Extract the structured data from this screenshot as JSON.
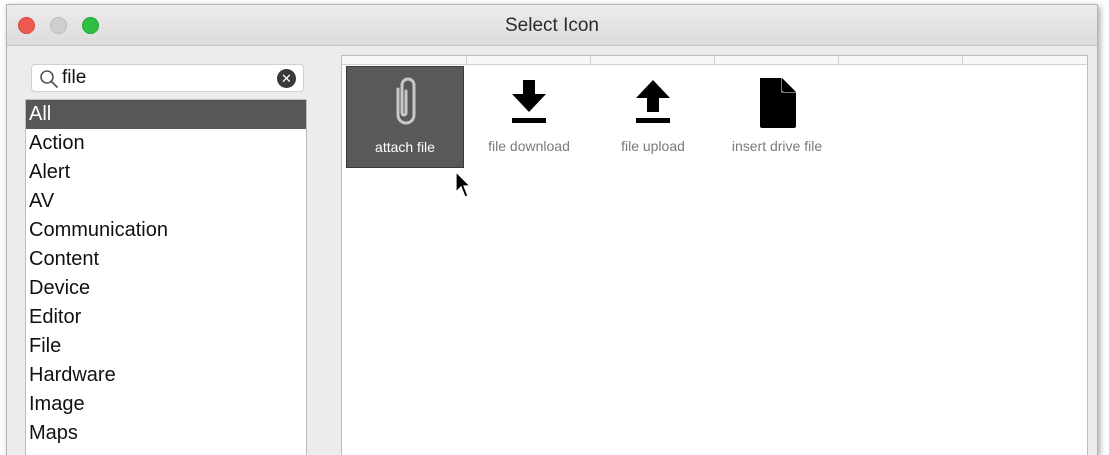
{
  "window": {
    "title": "Select Icon"
  },
  "search": {
    "value": "file"
  },
  "categories": [
    "All",
    "Action",
    "Alert",
    "AV",
    "Communication",
    "Content",
    "Device",
    "Editor",
    "File",
    "Hardware",
    "Image",
    "Maps"
  ],
  "selected_category": "All",
  "icons": [
    {
      "label": "attach file",
      "icon": "attach-file-icon",
      "selected": true
    },
    {
      "label": "file download",
      "icon": "file-download-icon",
      "selected": false
    },
    {
      "label": "file upload",
      "icon": "file-upload-icon",
      "selected": false
    },
    {
      "label": "insert drive file",
      "icon": "insert-drive-file-icon",
      "selected": false
    }
  ],
  "colors": {
    "selection": "#595959",
    "close": "#ee5a52",
    "maximize": "#2fc043"
  }
}
